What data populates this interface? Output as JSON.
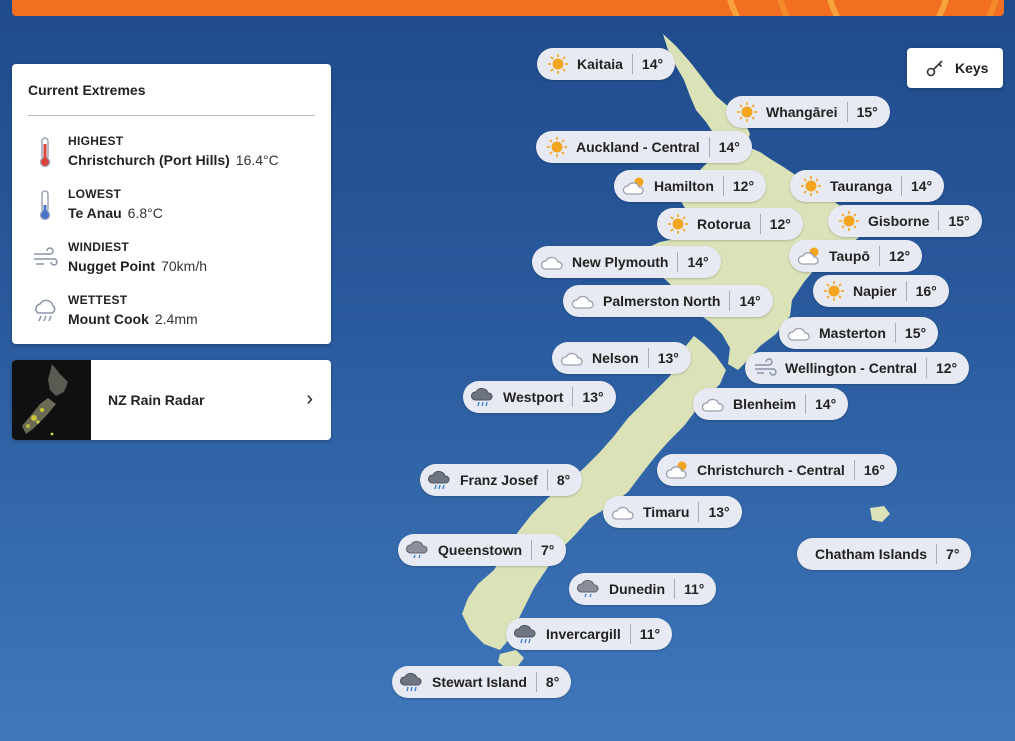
{
  "keys_label": "Keys",
  "extremes": {
    "title": "Current Extremes",
    "rows": [
      {
        "icon": "thermometer-hot-icon",
        "label": "HIGHEST",
        "place": "Christchurch (Port Hills)",
        "value": "16.4°C"
      },
      {
        "icon": "thermometer-cold-icon",
        "label": "LOWEST",
        "place": "Te Anau",
        "value": "6.8°C"
      },
      {
        "icon": "wind-icon",
        "label": "WINDIEST",
        "place": "Nugget Point",
        "value": "70km/h"
      },
      {
        "icon": "rain-cloud-icon",
        "label": "WETTEST",
        "place": "Mount Cook",
        "value": "2.4mm"
      }
    ]
  },
  "radar": {
    "label": "NZ Rain Radar"
  },
  "locations": [
    {
      "name": "Kaitaia",
      "temp": "14°",
      "weather": "sunny"
    },
    {
      "name": "Whangārei",
      "temp": "15°",
      "weather": "sunny"
    },
    {
      "name": "Auckland - Central",
      "temp": "14°",
      "weather": "sunny"
    },
    {
      "name": "Hamilton",
      "temp": "12°",
      "weather": "partly-cloudy"
    },
    {
      "name": "Tauranga",
      "temp": "14°",
      "weather": "sunny"
    },
    {
      "name": "Rotorua",
      "temp": "12°",
      "weather": "sunny"
    },
    {
      "name": "Gisborne",
      "temp": "15°",
      "weather": "sunny"
    },
    {
      "name": "New Plymouth",
      "temp": "14°",
      "weather": "cloudy"
    },
    {
      "name": "Taupō",
      "temp": "12°",
      "weather": "partly-cloudy"
    },
    {
      "name": "Palmerston North",
      "temp": "14°",
      "weather": "cloudy"
    },
    {
      "name": "Napier",
      "temp": "16°",
      "weather": "sunny"
    },
    {
      "name": "Masterton",
      "temp": "15°",
      "weather": "cloudy"
    },
    {
      "name": "Nelson",
      "temp": "13°",
      "weather": "cloudy"
    },
    {
      "name": "Wellington - Central",
      "temp": "12°",
      "weather": "windy"
    },
    {
      "name": "Westport",
      "temp": "13°",
      "weather": "rain"
    },
    {
      "name": "Blenheim",
      "temp": "14°",
      "weather": "cloudy"
    },
    {
      "name": "Christchurch - Central",
      "temp": "16°",
      "weather": "partly-cloudy"
    },
    {
      "name": "Franz Josef",
      "temp": "8°",
      "weather": "rain"
    },
    {
      "name": "Timaru",
      "temp": "13°",
      "weather": "cloudy"
    },
    {
      "name": "Chatham Islands",
      "temp": "7°",
      "weather": "none"
    },
    {
      "name": "Queenstown",
      "temp": "7°",
      "weather": "drizzle"
    },
    {
      "name": "Dunedin",
      "temp": "11°",
      "weather": "drizzle"
    },
    {
      "name": "Invercargill",
      "temp": "11°",
      "weather": "rain"
    },
    {
      "name": "Stewart Island",
      "temp": "8°",
      "weather": "rain"
    }
  ]
}
